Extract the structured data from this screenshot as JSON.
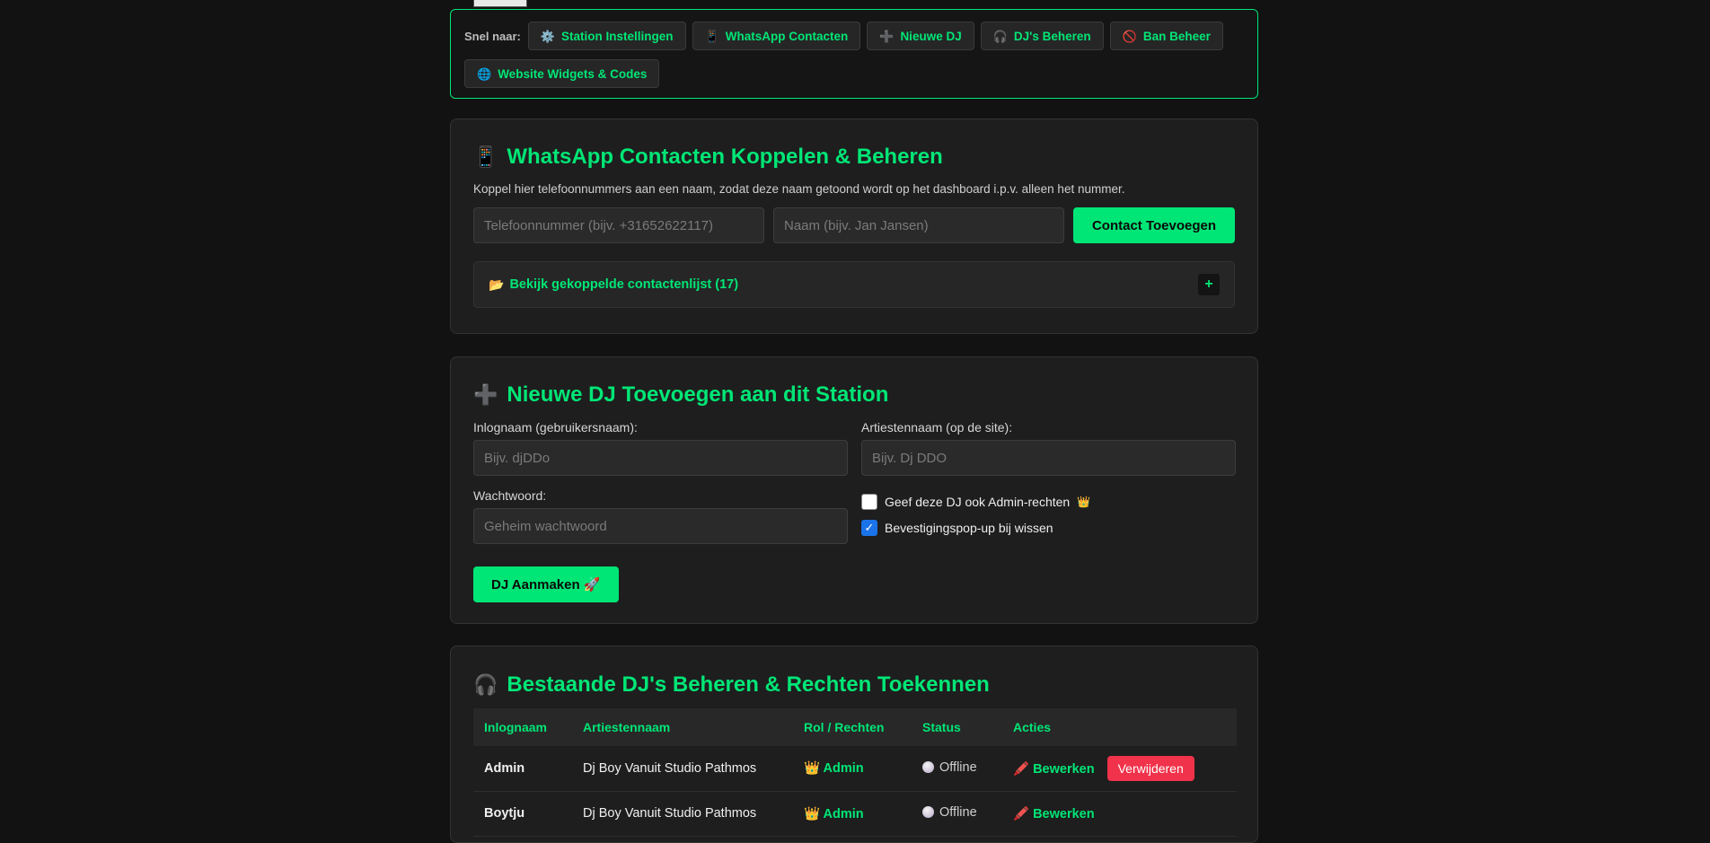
{
  "quicknav": {
    "label": "Snel naar:",
    "items": [
      {
        "icon": "gear-icon",
        "glyph": "⚙️",
        "label": "Station Instellingen"
      },
      {
        "icon": "phone-icon",
        "glyph": "📱",
        "label": "WhatsApp Contacten"
      },
      {
        "icon": "plus-icon",
        "glyph": "➕",
        "label": "Nieuwe DJ"
      },
      {
        "icon": "headphones-icon",
        "glyph": "🎧",
        "label": "DJ's Beheren"
      },
      {
        "icon": "ban-icon",
        "glyph": "🚫",
        "label": "Ban Beheer"
      },
      {
        "icon": "globe-icon",
        "glyph": "🌐",
        "label": "Website Widgets & Codes"
      }
    ]
  },
  "whatsapp": {
    "icon_glyph": "📱",
    "title": "WhatsApp Contacten Koppelen & Beheren",
    "description": "Koppel hier telefoonnummers aan een naam, zodat deze naam getoond wordt op het dashboard i.p.v. alleen het nummer.",
    "phone_placeholder": "Telefoonnummer (bijv. +31652622117)",
    "name_placeholder": "Naam (bijv. Jan Jansen)",
    "add_button": "Contact Toevoegen",
    "list_icon_glyph": "📂",
    "list_toggle": "Bekijk gekoppelde contactenlijst (17)",
    "expand_glyph": "+"
  },
  "new_dj": {
    "icon_glyph": "➕",
    "title": "Nieuwe DJ Toevoegen aan dit Station",
    "login_label": "Inlognaam (gebruikersnaam):",
    "login_placeholder": "Bijv. djDDo",
    "artist_label": "Artiestennaam (op de site):",
    "artist_placeholder": "Bijv. Dj DDO",
    "password_label": "Wachtwoord:",
    "password_placeholder": "Geheim wachtwoord",
    "admin_checkbox": "Geef deze DJ ook Admin-rechten",
    "admin_glyph": "👑",
    "admin_checked": false,
    "confirm_checkbox": "Bevestigingspop-up bij wissen",
    "confirm_checked": true,
    "create_button": "DJ Aanmaken 🚀"
  },
  "manage": {
    "icon_glyph": "🎧",
    "title": "Bestaande DJ's Beheren & Rechten Toekennen",
    "columns": [
      "Inlognaam",
      "Artiestennaam",
      "Rol / Rechten",
      "Status",
      "Acties"
    ],
    "rows": [
      {
        "login": "Admin",
        "artist": "Dj Boy Vanuit Studio Pathmos",
        "role": "👑 Admin",
        "status": "Offline",
        "edit": "🖍️ Bewerken",
        "delete": "Verwijderen"
      },
      {
        "login": "Boytju",
        "artist": "Dj Boy Vanuit Studio Pathmos",
        "role": "👑 Admin",
        "status": "Offline",
        "edit": "🖍️ Bewerken",
        "delete": ""
      }
    ]
  }
}
